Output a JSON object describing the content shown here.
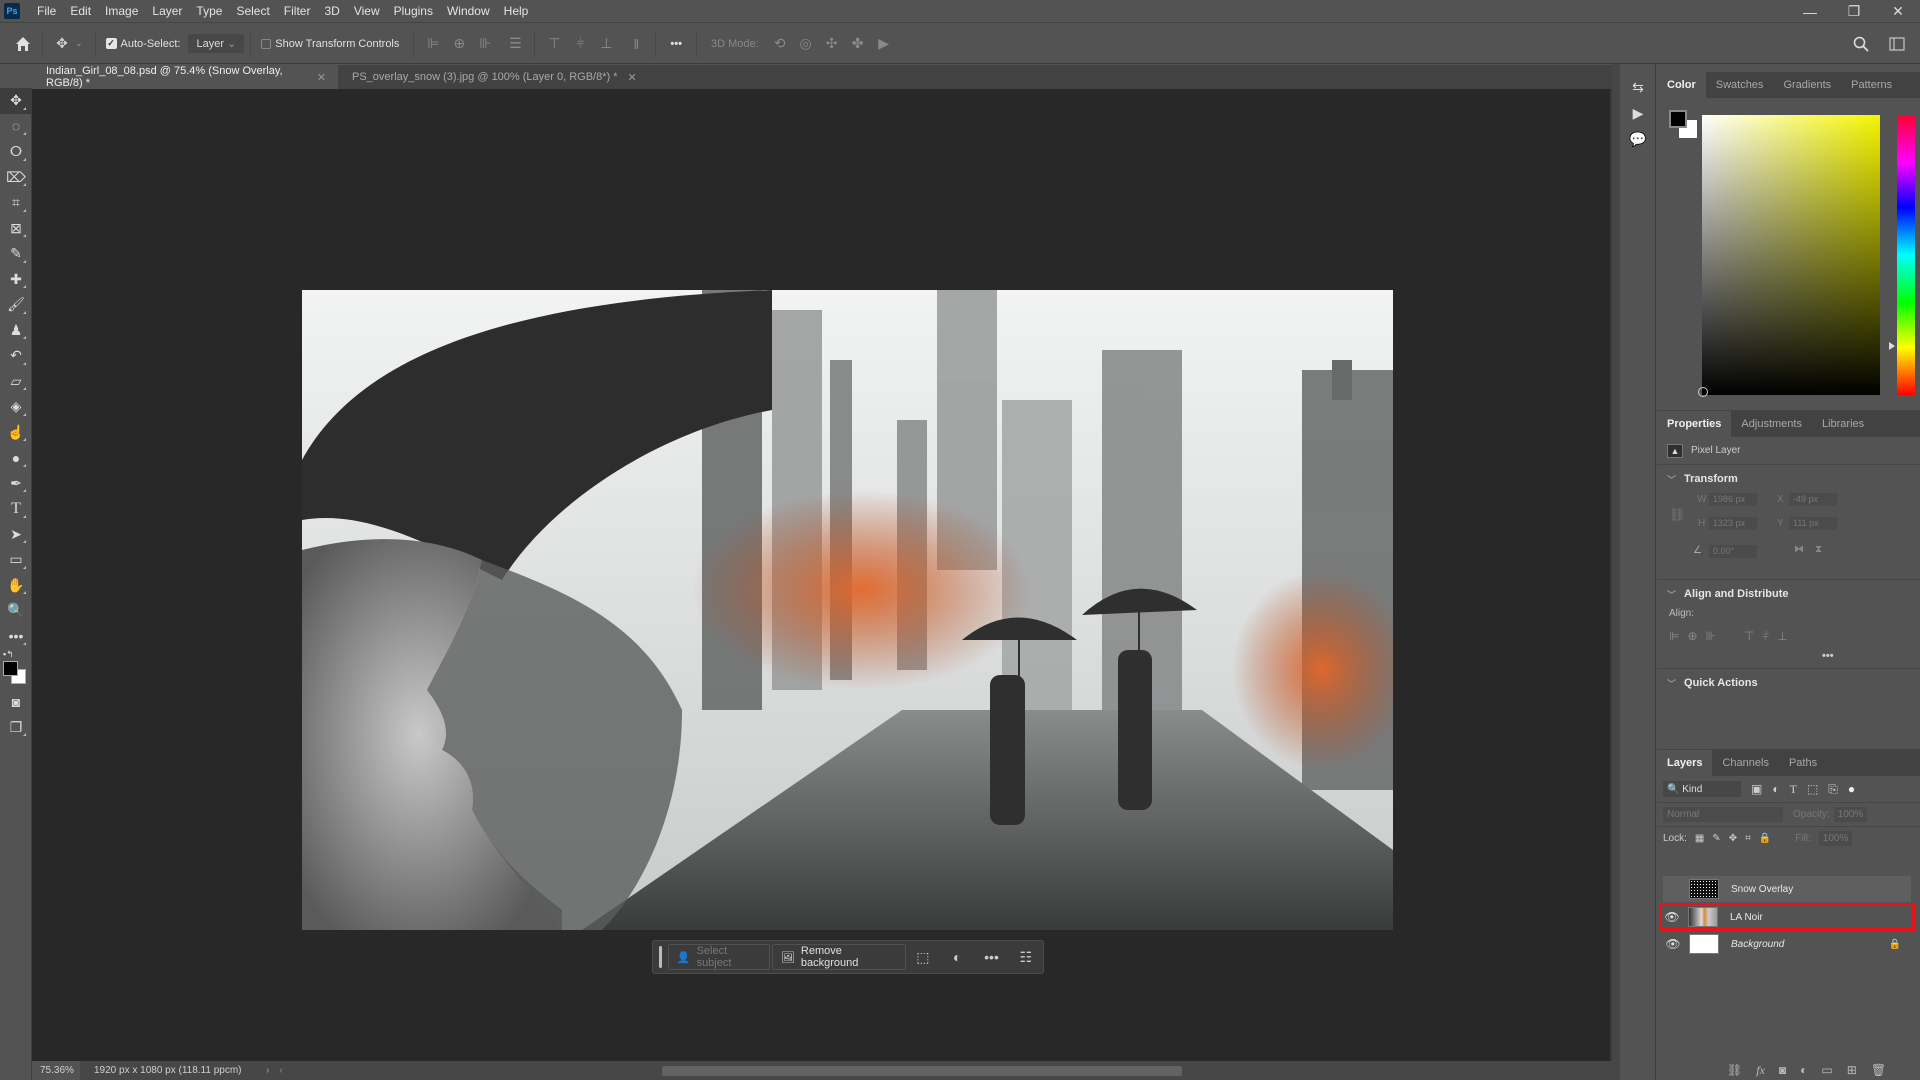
{
  "app": {
    "logo": "Ps"
  },
  "menu": [
    "File",
    "Edit",
    "Image",
    "Layer",
    "Type",
    "Select",
    "Filter",
    "3D",
    "View",
    "Plugins",
    "Window",
    "Help"
  ],
  "window_controls": {
    "minimize": "—",
    "restore": "❐",
    "close": "✕"
  },
  "options_bar": {
    "auto_select_label": "Auto-Select:",
    "auto_select_checked": true,
    "layer_dropdown": "Layer",
    "show_transform_label": "Show Transform Controls",
    "show_transform_checked": false,
    "more_label": "•••",
    "mode_3d_label": "3D Mode:"
  },
  "doc_tabs": [
    {
      "title": "Indian_Girl_08_08.psd @ 75.4% (Snow Overlay, RGB/8) *",
      "active": true
    },
    {
      "title": "PS_overlay_snow (3).jpg @ 100% (Layer 0, RGB/8*) *",
      "active": false
    }
  ],
  "tools": [
    "move-tool",
    "marquee-tool",
    "lasso-tool",
    "object-selection-tool",
    "crop-tool",
    "frame-tool",
    "eyedropper-tool",
    "healing-brush-tool",
    "brush-tool",
    "clone-stamp-tool",
    "history-brush-tool",
    "eraser-tool",
    "paint-bucket-tool",
    "blur-tool",
    "dodge-tool",
    "pen-tool",
    "type-tool",
    "path-selection-tool",
    "rectangle-tool",
    "hand-tool",
    "zoom-tool",
    "edit-toolbar"
  ],
  "canvas": {
    "description": "Double-exposure composite: woman in hat in profile blended with rainy noir city street with two figures holding umbrellas"
  },
  "contextual_bar": {
    "select_subject": "Select subject",
    "remove_background": "Remove background",
    "more": "•••"
  },
  "status": {
    "zoom": "75.36%",
    "doc_size": "1920 px x 1080 px (118.11 ppcm)"
  },
  "color_panel": {
    "tabs": [
      "Color",
      "Swatches",
      "Gradients",
      "Patterns"
    ],
    "active_tab": "Color",
    "foreground": "#000000",
    "background": "#ffffff",
    "hue_color": "#f5f500"
  },
  "properties_panel": {
    "tabs": [
      "Properties",
      "Adjustments",
      "Libraries"
    ],
    "active_tab": "Properties",
    "layer_type": "Pixel Layer",
    "transform_title": "Transform",
    "w_label": "W",
    "w_value": "1986 px",
    "h_label": "H",
    "h_value": "1323 px",
    "x_label": "X",
    "x_value": "-49 px",
    "y_label": "Y",
    "y_value": "111 px",
    "angle_value": "0.00°",
    "align_title": "Align and Distribute",
    "align_label": "Align:",
    "more": "•••",
    "quick_actions_title": "Quick Actions"
  },
  "layers_panel": {
    "tabs": [
      "Layers",
      "Channels",
      "Paths"
    ],
    "active_tab": "Layers",
    "filter_kind": "Kind",
    "blend_mode": "Normal",
    "opacity_label": "Opacity:",
    "opacity_value": "100%",
    "lock_label": "Lock:",
    "fill_label": "Fill:",
    "fill_value": "100%",
    "layers": [
      {
        "name": "Snow Overlay",
        "visible": false,
        "selected": true,
        "locked": false,
        "italic": false
      },
      {
        "name": "LA Noir",
        "visible": true,
        "selected": false,
        "locked": false,
        "italic": false,
        "highlighted": true
      },
      {
        "name": "Background",
        "visible": true,
        "selected": false,
        "locked": true,
        "italic": true
      }
    ],
    "highlight_color": "#e8131b"
  }
}
